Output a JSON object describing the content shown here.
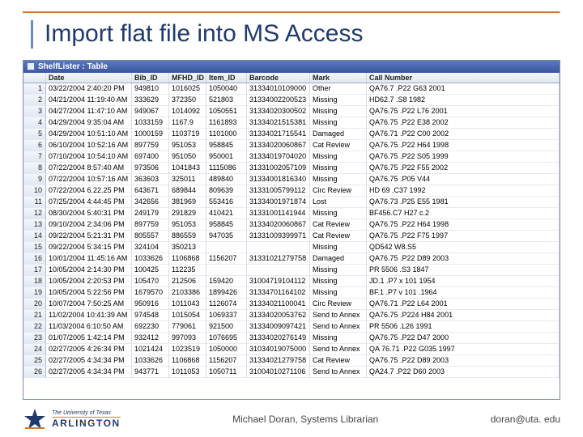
{
  "title": "Import flat file into MS Access",
  "window_caption": "ShelfLister : Table",
  "columns": [
    "",
    "Date",
    "Bib_ID",
    "MFHD_ID",
    "Item_ID",
    "Barcode",
    "Mark",
    "Call Number"
  ],
  "rows": [
    {
      "n": "1",
      "date": "03/22/2004 2:40:20 PM",
      "bib": "949810",
      "mfhd": "1016025",
      "item": "1050040",
      "barcode": "31334010109000",
      "mark": "Other",
      "call": "QA76.7 .P22 G63 2001"
    },
    {
      "n": "2",
      "date": "04/21/2004 11:19:40 AM",
      "bib": "333629",
      "mfhd": "372350",
      "item": "521803",
      "barcode": "31334002200523",
      "mark": "Missing",
      "call": "HD62.7 .S8 1982"
    },
    {
      "n": "3",
      "date": "04/27/2004 11:47:10 AM",
      "bib": "949067",
      "mfhd": "1014092",
      "item": "1050551",
      "barcode": "31334020300502",
      "mark": "Missing",
      "call": "QA76.75 .P22 L76 2001"
    },
    {
      "n": "4",
      "date": "04/29/2004 9:35:04 AM",
      "bib": "1033159",
      "mfhd": "1167.9",
      "item": "1161893",
      "barcode": "31334021515381",
      "mark": "Missing",
      "call": "QA76.75 .P22 E38 2002"
    },
    {
      "n": "5",
      "date": "04/29/2004 10:51:10 AM",
      "bib": "1000159",
      "mfhd": "1103719",
      "item": "1101000",
      "barcode": "31334021715541",
      "mark": "Damaged",
      "call": "QA76.71 .P22 C00 2002"
    },
    {
      "n": "6",
      "date": "06/10/2004 10:52:16 AM",
      "bib": "897759",
      "mfhd": "951053",
      "item": "958845",
      "barcode": "31334020060867",
      "mark": "Cat Review",
      "call": "QA76.75 .P22 H64 1998"
    },
    {
      "n": "7",
      "date": "07/10/2004 10:54:10 AM",
      "bib": "697400",
      "mfhd": "951050",
      "item": "950001",
      "barcode": "31334019704020",
      "mark": "Missing",
      "call": "QA76.75 .P22 S05 1999"
    },
    {
      "n": "8",
      "date": "07/22/2004 8:57:40 AM",
      "bib": "973506",
      "mfhd": "1041843",
      "item": "1115086",
      "barcode": "31331002057109",
      "mark": "Missing",
      "call": "QA76.75 .P22 F55 2002"
    },
    {
      "n": "9",
      "date": "07/22/2004 10:57:16 AM",
      "bib": "363603",
      "mfhd": "325011",
      "item": "489840",
      "barcode": "31334001816340",
      "mark": "Missing",
      "call": "QA76.75 .P05 V44"
    },
    {
      "n": "10",
      "date": "07/22/2004 6.22.25 PM",
      "bib": "643671",
      "mfhd": "689844",
      "item": "809639",
      "barcode": "31331005799112",
      "mark": "Circ Review",
      "call": "HD 69 .C37 1992"
    },
    {
      "n": "11",
      "date": "07/25/2004 4:44:45 PM",
      "bib": "342656",
      "mfhd": "381969",
      "item": "553416",
      "barcode": "31334001971874",
      "mark": "Lost",
      "call": "QA76.73 .P25 E55 1981"
    },
    {
      "n": "12",
      "date": "08/30/2004 5:40:31 PM",
      "bib": "249179",
      "mfhd": "291829",
      "item": "410421",
      "barcode": "31331001141944",
      "mark": "Missing",
      "call": "BF456.C7 H27 c.2"
    },
    {
      "n": "13",
      "date": "09/10/2004 2:34:06 PM",
      "bib": "897759",
      "mfhd": "951053",
      "item": "958845",
      "barcode": "31334020060867",
      "mark": "Cat Review",
      "call": "QA76.75 .P22 H64 1998"
    },
    {
      "n": "14",
      "date": "09/22/2004 5:21:31 PM",
      "bib": "805557",
      "mfhd": "886559",
      "item": "947035",
      "barcode": "31331009399971",
      "mark": "Cat Review",
      "call": "QA76.75 .P22 F75 1997"
    },
    {
      "n": "15",
      "date": "09/22/2004 5:34:15 PM",
      "bib": "324104",
      "mfhd": "350213",
      "item": "",
      "barcode": "",
      "mark": "Missing",
      "call": "QD542 W8.S5"
    },
    {
      "n": "16",
      "date": "10/01/2004 11:45:16 AM",
      "bib": "1033626",
      "mfhd": "1106868",
      "item": "1156207",
      "barcode": "31331021279758",
      "mark": "Damaged",
      "call": "QA76.75 .P22 D89 2003"
    },
    {
      "n": "17",
      "date": "10/05/2004 2:14:30 PM",
      "bib": "100425",
      "mfhd": "112235",
      "item": "",
      "barcode": "",
      "mark": "Missing",
      "call": "PR 5506 .S3 1847"
    },
    {
      "n": "18",
      "date": "10/05/2004 2:20:53 PM",
      "bib": "105470",
      "mfhd": "212506",
      "item": "159420",
      "barcode": "31004719104112",
      "mark": "Missing",
      "call": "JD.1 .P7 x 101 1954"
    },
    {
      "n": "19",
      "date": "10/05/2004 5:22:56 PM",
      "bib": "1679570",
      "mfhd": "2103386",
      "item": "1899426",
      "barcode": "31334701164102",
      "mark": "Missing",
      "call": "BF.1 .P7 v 101 .1964"
    },
    {
      "n": "20",
      "date": "10/07/2004 7:50:25 AM",
      "bib": "950916",
      "mfhd": "1011043",
      "item": "1126074",
      "barcode": "31334021100041",
      "mark": "Circ Review",
      "call": "QA76.71 .P22 L64 2001"
    },
    {
      "n": "21",
      "date": "11/02/2004 10:41:39 AM",
      "bib": "974548",
      "mfhd": "1015054",
      "item": "1069337",
      "barcode": "31334020053762",
      "mark": "Send to Annex",
      "call": "QA76.75 .P224 H84 2001"
    },
    {
      "n": "22",
      "date": "11/03/2004 6:10:50 AM",
      "bib": "692230",
      "mfhd": "779061",
      "item": "921500",
      "barcode": "31334009097421",
      "mark": "Send to Annex",
      "call": "PR 5506 .L26 1991"
    },
    {
      "n": "23",
      "date": "01/07/2005 1:42:14 PM",
      "bib": "932412",
      "mfhd": "997093",
      "item": "1076695",
      "barcode": "31334020276149",
      "mark": "Missing",
      "call": "QA76.75 .P22 D47 2000"
    },
    {
      "n": "24",
      "date": "02/27/2005 4:26:34 PM",
      "bib": "1021424",
      "mfhd": "1023519",
      "item": "1050000",
      "barcode": "31034019075000",
      "mark": "Send to Annex",
      "call": "QA 76.71 .P22 G035 1997"
    },
    {
      "n": "25",
      "date": "02/27/2005 4:34:34 PM",
      "bib": "1033626",
      "mfhd": "1106868",
      "item": "1156207",
      "barcode": "31334021279758",
      "mark": "Cat Review",
      "call": "QA76.75 .P22 D89 2003"
    },
    {
      "n": "26",
      "date": "02/27/2005 4:34:34 PM",
      "bib": "943771",
      "mfhd": "1011053",
      "item": "1050711",
      "barcode": "31004010271106",
      "mark": "Send to Annex",
      "call": "QA24.7 .P22 D60 2003"
    }
  ],
  "footer": {
    "center": "Michael Doran, Systems Librarian",
    "right": "doran@uta. edu",
    "logo_line1": "The University of Texas",
    "logo_line2": "ARLINGTON"
  }
}
